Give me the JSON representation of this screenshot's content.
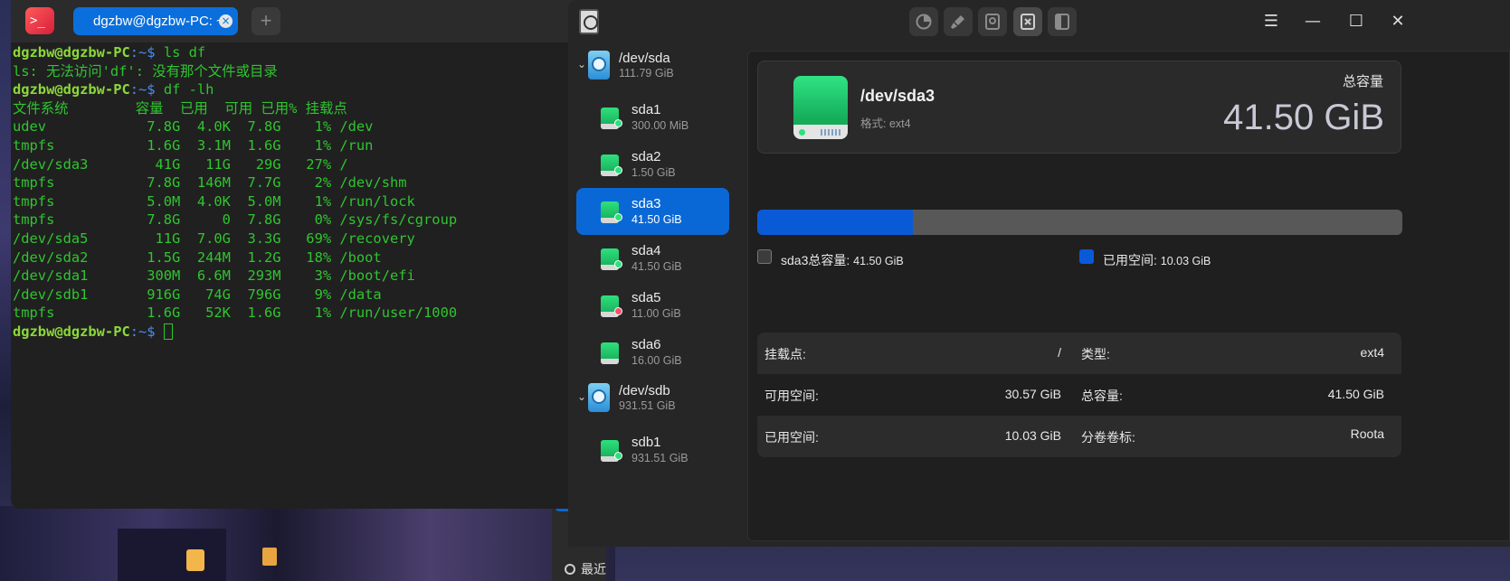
{
  "terminal": {
    "tab_title": "dgzbw@dgzbw-PC: ~",
    "add_tab": "+",
    "tab_close": "×",
    "lines": [
      {
        "user": "dgzbw@dgzbw-PC",
        "path": ":~$ ",
        "cmd": "ls df"
      },
      {
        "text": "ls: 无法访问'df': 没有那个文件或目录"
      },
      {
        "user": "dgzbw@dgzbw-PC",
        "path": ":~$ ",
        "cmd": "df -lh"
      },
      {
        "text": "文件系统        容量  已用  可用 已用% 挂载点"
      },
      {
        "text": "udev            7.8G  4.0K  7.8G    1% /dev"
      },
      {
        "text": "tmpfs           1.6G  3.1M  1.6G    1% /run"
      },
      {
        "text": "/dev/sda3        41G   11G   29G   27% /"
      },
      {
        "text": "tmpfs           7.8G  146M  7.7G    2% /dev/shm"
      },
      {
        "text": "tmpfs           5.0M  4.0K  5.0M    1% /run/lock"
      },
      {
        "text": "tmpfs           7.8G     0  7.8G    0% /sys/fs/cgroup"
      },
      {
        "text": "/dev/sda5        11G  7.0G  3.3G   69% /recovery"
      },
      {
        "text": "/dev/sda2       1.5G  244M  1.2G   18% /boot"
      },
      {
        "text": "/dev/sda1       300M  6.6M  293M    3% /boot/efi"
      },
      {
        "text": "/dev/sdb1       916G   74G  796G    9% /data"
      },
      {
        "text": "tmpfs           1.6G   52K  1.6G    1% /run/user/1000"
      },
      {
        "user": "dgzbw@dgzbw-PC",
        "path": ":~$ ",
        "cmd": ""
      }
    ]
  },
  "behind_window": {
    "label": "最近"
  },
  "disk_util": {
    "disks": [
      {
        "name": "/dev/sda",
        "size": "111.79 GiB",
        "partitions": [
          {
            "name": "sda1",
            "size": "300.00 MiB"
          },
          {
            "name": "sda2",
            "size": "1.50 GiB"
          },
          {
            "name": "sda3",
            "size": "41.50 GiB"
          },
          {
            "name": "sda4",
            "size": "41.50 GiB"
          },
          {
            "name": "sda5",
            "size": "11.00 GiB"
          },
          {
            "name": "sda6",
            "size": "16.00 GiB"
          }
        ]
      },
      {
        "name": "/dev/sdb",
        "size": "931.51 GiB",
        "partitions": [
          {
            "name": "sdb1",
            "size": "931.51 GiB"
          }
        ]
      }
    ],
    "selected": {
      "name": "/dev/sda3",
      "fs": "格式: ext4",
      "capacity_label": "总容量",
      "capacity_value": "41.50 GiB",
      "used_fraction": 0.2417
    },
    "legend": {
      "total_label": "sda3总容量:",
      "total_value": "41.50 GiB",
      "used_label": "已用空间:",
      "used_value": "10.03 GiB"
    },
    "props": {
      "mount_label": "挂载点:",
      "mount_value": "/",
      "type_label": "类型:",
      "type_value": "ext4",
      "free_label": "可用空间:",
      "free_value": "30.57 GiB",
      "total_label": "总容量:",
      "total_value": "41.50 GiB",
      "used_label": "已用空间:",
      "used_value": "10.03 GiB",
      "vol_label": "分卷卷标:",
      "vol_value": "Roota"
    },
    "colors": {
      "used": "#0a5ad8",
      "free": "#585858",
      "selected": "#0a68d6"
    }
  }
}
